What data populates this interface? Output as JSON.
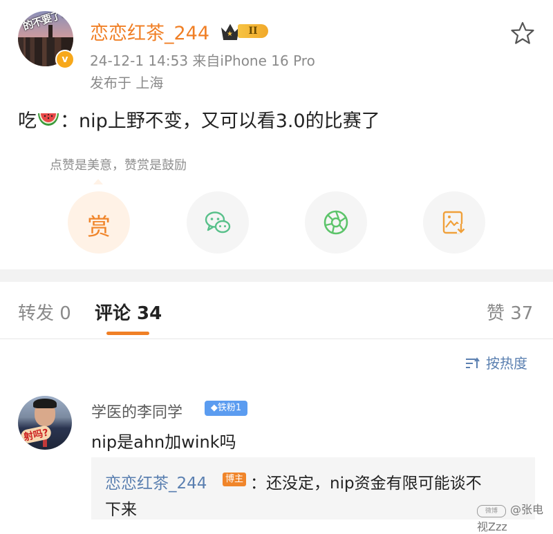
{
  "post": {
    "author": "恋恋红茶_244",
    "level_badge": "II",
    "avatar_text": "的不要了?",
    "verified_mark": "v",
    "meta": "24-12-1 14:53  来自iPhone 16 Pro",
    "location": "发布于 上海",
    "text_prefix": "吃",
    "text_body": "：nip上野不变，又可以看3.0的比赛了",
    "reward_hint": "点赞是美意，赞赏是鼓励",
    "reward_button": "赏"
  },
  "tabs": {
    "repost": "转发 0",
    "comments": "评论 34",
    "likes": "赞 37"
  },
  "sort": {
    "label": "按热度"
  },
  "comments": [
    {
      "user": "学医的李同学",
      "fan_badge": "◆铁粉1",
      "avatar_text": "射吗?",
      "text": "nip是ahn加wink吗",
      "reply": {
        "user": "恋恋红茶_244",
        "owner_badge": "博主",
        "text_line1": "：还没定，nip资金有限可能谈不",
        "text_line2": "下来"
      }
    }
  ],
  "watermark": {
    "logo": "微博",
    "text": "@张电视Zzz"
  },
  "colors": {
    "accent": "#f07f25",
    "link": "#5a7fb0",
    "muted": "#8a8a8a",
    "wechat_green": "#58c08a",
    "moments_green": "#5cc46a",
    "save_orange": "#f0a03a"
  },
  "icons": [
    "star-icon",
    "wechat-icon",
    "moments-icon",
    "save-image-icon",
    "sort-icon",
    "watermelon-icon"
  ]
}
